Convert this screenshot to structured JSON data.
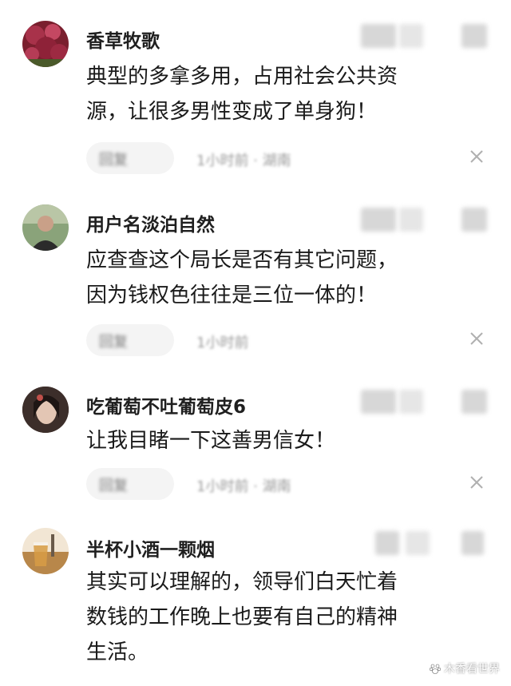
{
  "comments": [
    {
      "username": "香草牧歌",
      "text_lines": [
        "典型的多拿多用，占用社会公共资",
        "源，让很多男性变成了单身狗！"
      ],
      "reply_label": "回复",
      "meta": "1小时前 · 湖南"
    },
    {
      "username": "用户名淡泊自然",
      "text_lines": [
        "应查查这个局长是否有其它问题，",
        "因为钱权色往往是三位一体的！"
      ],
      "reply_label": "回复",
      "meta": "1小时前"
    },
    {
      "username": "吃葡萄不吐葡萄皮6",
      "text_lines": [
        "让我目睹一下这善男信女！"
      ],
      "reply_label": "回复",
      "meta": "1小时前 · 湖南"
    },
    {
      "username": "半杯小酒一颗烟",
      "text_lines": [
        "其实可以理解的，领导们白天忙着",
        "数钱的工作晚上也要有自己的精神",
        "生活。"
      ]
    }
  ],
  "watermark": {
    "text": "木香看世界",
    "icon": "paw-icon"
  },
  "colors": {
    "text": "#1a1a1a",
    "meta": "#999999",
    "pill": "#f4f4f4",
    "close": "#b0b0b0"
  }
}
